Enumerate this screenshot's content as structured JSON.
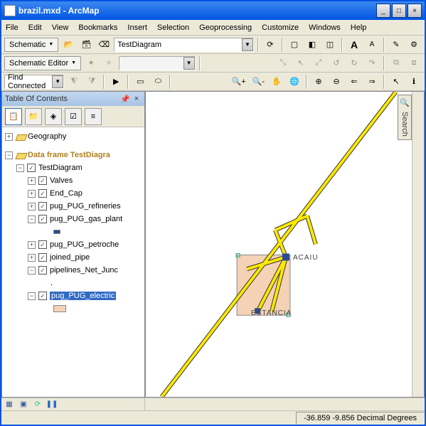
{
  "window": {
    "title": "brazil.mxd - ArcMap"
  },
  "menu": {
    "file": "File",
    "edit": "Edit",
    "view": "View",
    "bookmarks": "Bookmarks",
    "insert": "Insert",
    "selection": "Selection",
    "geoprocessing": "Geoprocessing",
    "customize": "Customize",
    "windows": "Windows",
    "help": "Help"
  },
  "toolbar1": {
    "schematic": "Schematic",
    "layer_combo": "TestDiagram",
    "a_large": "A",
    "a_small": "A"
  },
  "toolbar2": {
    "schematic_editor": "Schematic Editor"
  },
  "toolbar3": {
    "find_combo": "Find Connected"
  },
  "toc": {
    "title": "Table Of Contents",
    "items": {
      "geography": "Geography",
      "dataframe": "Data frame TestDiagra",
      "testdiagram": "TestDiagram",
      "valves": "Valves",
      "endcap": "End_Cap",
      "refineries": "pug_PUG_refineries",
      "gasplant": "pug_PUG_gas_plant",
      "petroche": "pug_PUG_petroche",
      "joinedpipe": "joined_pipe",
      "pipelines": "pipelines_Net_Junc",
      "dot": ".",
      "electric": "pug_PUG_electric"
    }
  },
  "map": {
    "label1": "ACAIU",
    "label2": "ESTANCIA"
  },
  "status": {
    "coords": "-36.859  -9.856 Decimal Degrees"
  },
  "sidetab": {
    "label": "Search"
  }
}
